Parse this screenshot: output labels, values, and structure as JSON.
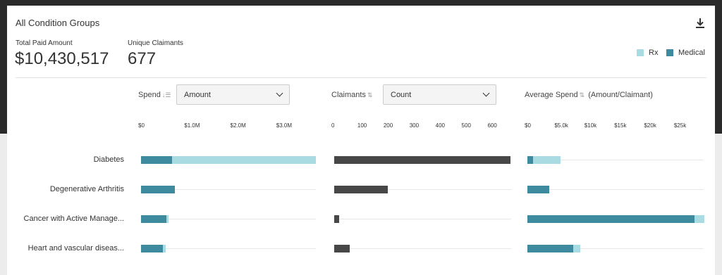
{
  "card": {
    "title": "All Condition Groups"
  },
  "icons": {
    "download": "download-icon"
  },
  "kpis": {
    "total_paid_label": "Total Paid Amount",
    "total_paid_value": "$10,430,517",
    "unique_claimants_label": "Unique Claimants",
    "unique_claimants_value": "677"
  },
  "legend": {
    "rx": {
      "label": "Rx",
      "color": "#a9dbe3"
    },
    "medical": {
      "label": "Medical",
      "color": "#3e8a9e"
    }
  },
  "columns": {
    "spend": {
      "header": "Spend",
      "sort_icon": "↓☰",
      "select_value": "Amount"
    },
    "claimants": {
      "header": "Claimants",
      "sort_icon": "⇅",
      "select_value": "Count"
    },
    "avg": {
      "header": "Average Spend",
      "sort_icon": "⇅",
      "suffix": "(Amount/Claimant)"
    }
  },
  "axes": {
    "spend_ticks": [
      "$0",
      "$1.0M",
      "$2.0M",
      "$3.0M"
    ],
    "claimant_ticks": [
      "0",
      "100",
      "200",
      "300",
      "400",
      "500",
      "600"
    ],
    "avg_ticks": [
      "$0",
      "$5.0k",
      "$10k",
      "$15k",
      "$20k",
      "$25k"
    ]
  },
  "rows": [
    {
      "label": "Diabetes",
      "spend_medical": 0.67,
      "spend_rx": 3.13,
      "claimants": 677,
      "avg_medical": 1000,
      "avg_rx": 4600
    },
    {
      "label": "Degenerative Arthritis",
      "spend_medical": 0.74,
      "spend_rx": 0.0,
      "claimants": 207,
      "avg_medical": 3600,
      "avg_rx": 0
    },
    {
      "label": "Cancer with Active Manage...",
      "spend_medical": 0.55,
      "spend_rx": 0.04,
      "claimants": 20,
      "avg_medical": 28000,
      "avg_rx": 1600
    },
    {
      "label": "Heart and vascular diseas...",
      "spend_medical": 0.47,
      "spend_rx": 0.06,
      "claimants": 60,
      "avg_medical": 7700,
      "avg_rx": 1100
    }
  ],
  "scales": {
    "spend_max": 3.8,
    "claimants_max": 680,
    "avg_max": 29500
  }
}
